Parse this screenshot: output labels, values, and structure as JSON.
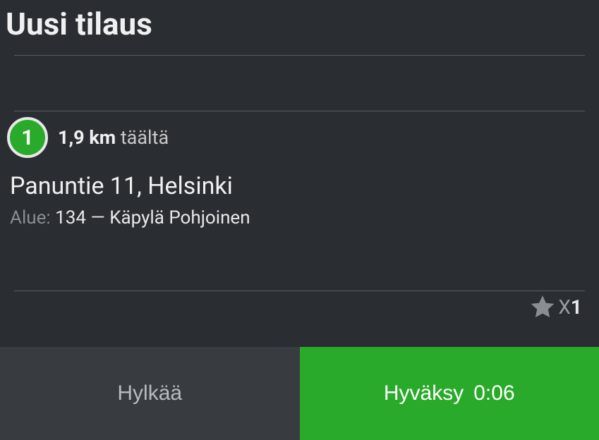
{
  "header": {
    "title": "Uusi tilaus"
  },
  "order": {
    "badge_number": "1",
    "distance_value": "1,9 km",
    "distance_suffix": " täältä",
    "address": "Panuntie 11, Helsinki",
    "area_label": "Alue:",
    "area_value": " 134 — Käpylä Pohjoinen"
  },
  "rating": {
    "multiplier_prefix": "X",
    "multiplier_value": "1"
  },
  "buttons": {
    "reject": "Hylkää",
    "accept": "Hyväksy",
    "timer": "0:06"
  },
  "colors": {
    "accent": "#2aaa2a",
    "bg_dark": "#2a2d32",
    "bg_button_dark": "#383b40"
  }
}
